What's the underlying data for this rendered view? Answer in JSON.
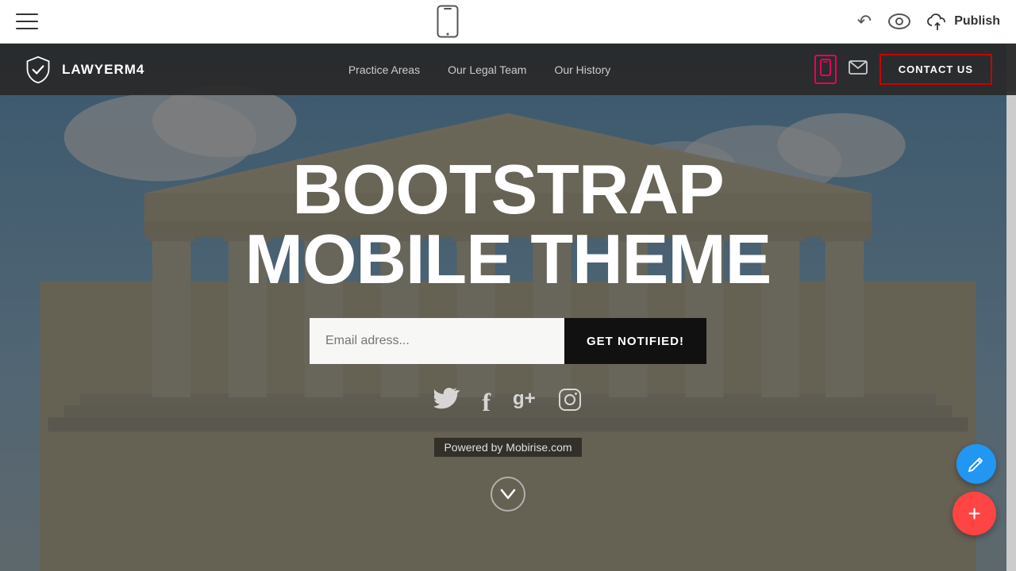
{
  "editor": {
    "publish_label": "Publish",
    "hamburger_aria": "Menu",
    "phone_preview_aria": "Mobile Preview",
    "undo_aria": "Undo",
    "eye_aria": "Preview",
    "cloud_aria": "Upload"
  },
  "navbar": {
    "brand_name": "LAWYERM4",
    "links": [
      {
        "label": "Practice Areas",
        "id": "practice-areas"
      },
      {
        "label": "Our Legal Team",
        "id": "our-legal-team"
      },
      {
        "label": "Our History",
        "id": "our-history"
      }
    ],
    "contact_label": "CONTACT US"
  },
  "hero": {
    "title_line1": "BOOTSTRAP",
    "title_line2": "MOBILE THEME",
    "email_placeholder": "Email adress...",
    "notify_label": "GET NOTIFIED!",
    "powered_by": "Powered by Mobirise.com",
    "social": [
      {
        "name": "twitter",
        "symbol": "🐦"
      },
      {
        "name": "facebook",
        "symbol": "f"
      },
      {
        "name": "google-plus",
        "symbol": "g+"
      },
      {
        "name": "instagram",
        "symbol": "◻"
      }
    ]
  },
  "colors": {
    "accent_red": "#cc0000",
    "fab_blue": "#2196F3",
    "fab_red": "#ff4444",
    "navbar_bg": "rgba(40,40,40,0.92)"
  }
}
